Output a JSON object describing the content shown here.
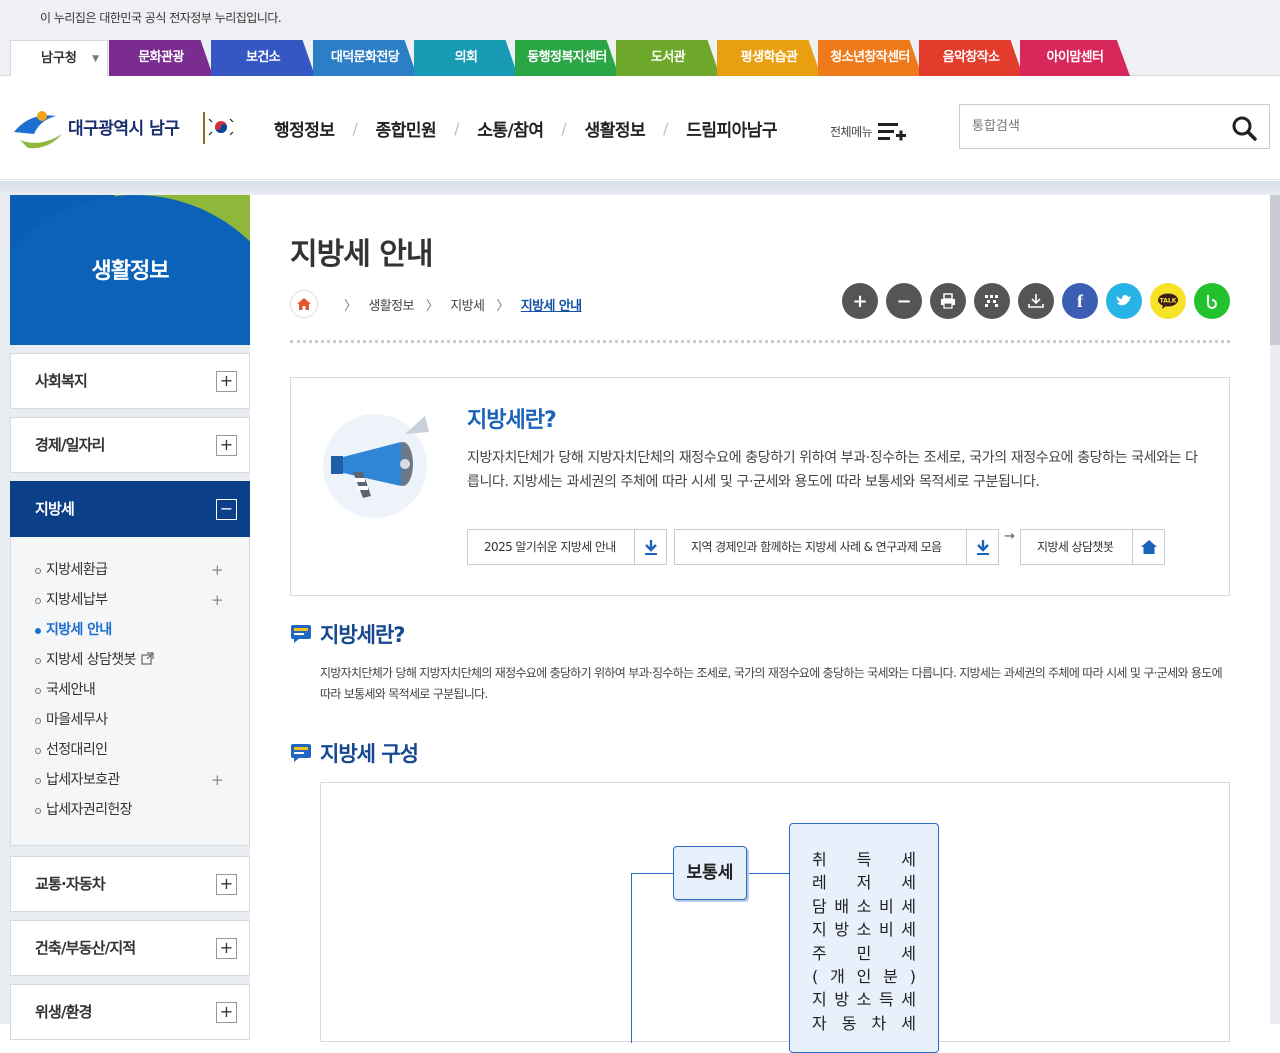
{
  "notice": "이 누리집은 대한민국 공식 전자정부 누리집입니다.",
  "site_tabs": {
    "first": "남구청",
    "items": [
      {
        "label": "문화관광",
        "color": "#7a2c8f"
      },
      {
        "label": "보건소",
        "color": "#3557c4"
      },
      {
        "label": "대덕문화전당",
        "color": "#2c7fc7"
      },
      {
        "label": "의회",
        "color": "#1a9bb5"
      },
      {
        "label": "동행정복지센터",
        "color": "#2aa645"
      },
      {
        "label": "도서관",
        "color": "#6ea82b"
      },
      {
        "label": "평생학습관",
        "color": "#e8a010"
      },
      {
        "label": "청소년창작센터",
        "color": "#ee7a1b"
      },
      {
        "label": "음악창작소",
        "color": "#e33b2c"
      },
      {
        "label": "아이맘센터",
        "color": "#d8275a"
      }
    ]
  },
  "header": {
    "logo_text": "대구광역시 남구",
    "gnb": [
      "행정정보",
      "종합민원",
      "소통/참여",
      "생활정보",
      "드림피아남구"
    ],
    "all_menu": "전체메뉴",
    "search_placeholder": "통합검색"
  },
  "sidebar": {
    "title": "생활정보",
    "menu_top": [
      {
        "label": "사회복지",
        "toggle": "+"
      },
      {
        "label": "경제/일자리",
        "toggle": "+"
      }
    ],
    "active": {
      "label": "지방세",
      "toggle": "−"
    },
    "sub_items": [
      {
        "label": "지방세환급",
        "plus": "+"
      },
      {
        "label": "지방세납부",
        "plus": "+"
      },
      {
        "label": "지방세 안내"
      },
      {
        "label": "지방세 상담챗봇"
      },
      {
        "label": "국세안내"
      },
      {
        "label": "마을세무사"
      },
      {
        "label": "선정대리인"
      },
      {
        "label": "납세자보호관",
        "plus": "+"
      },
      {
        "label": "납세자권리헌장"
      }
    ],
    "menu_bottom": [
      {
        "label": "교통·자동차",
        "toggle": "+"
      },
      {
        "label": "건축/부동산/지적",
        "toggle": "+"
      },
      {
        "label": "위생/환경",
        "toggle": "+"
      }
    ]
  },
  "content": {
    "title": "지방세 안내",
    "breadcrumb": [
      "생활정보",
      "지방세",
      "지방세 안내"
    ],
    "tools": [
      {
        "name": "zoom-in",
        "symbol": "+",
        "color": "#555555"
      },
      {
        "name": "zoom-out",
        "symbol": "−",
        "color": "#555555"
      },
      {
        "name": "print",
        "color": "#555555"
      },
      {
        "name": "qr",
        "color": "#555555"
      },
      {
        "name": "download",
        "color": "#555555"
      },
      {
        "name": "facebook",
        "symbol": "f",
        "color": "#3b5db3"
      },
      {
        "name": "twitter",
        "color": "#27b3e6"
      },
      {
        "name": "kakaotalk",
        "color": "#f7e22a"
      },
      {
        "name": "band",
        "color": "#22c22e"
      }
    ],
    "intro": {
      "heading": "지방세란?",
      "text": "지방자치단체가 당해 지방자치단체의 재정수요에 충당하기 위하여 부과·징수하는 조세로, 국가의 재정수요에 충당하는 국세와는 다릅니다. 지방세는 과세권의 주체에 따라 시세 및 구·군세와 용도에 따라 보통세와 목적세로 구분됩니다.",
      "btn1": "2025 알기쉬운 지방세 안내",
      "btn2": "지역 경제인과 함께하는 지방세 사례 & 연구과제 모음",
      "arrow": "→",
      "btn3": "지방세 상담챗봇"
    },
    "section1": {
      "heading": "지방세란?",
      "text": "지방자치단체가 당해 지방자치단체의 재정수요에 충당하기 위하여 부과·징수하는 조세로, 국가의 재정수요에 충당하는 국세와는 다릅니다. 지방세는 과세권의 주체에 따라 시세 및 구·군세와 용도에 따라 보통세와 목적세로 구분됩니다."
    },
    "section2": {
      "heading": "지방세 구성",
      "node": "보통세",
      "taxes": [
        [
          "취",
          "득",
          "세"
        ],
        [
          "레",
          "저",
          "세"
        ],
        [
          "담",
          "배",
          "소",
          "비",
          "세"
        ],
        [
          "지",
          "방",
          "소",
          "비",
          "세"
        ],
        [
          "주",
          "민",
          "세"
        ],
        [
          "(",
          "개",
          "인",
          "분",
          ")"
        ],
        [
          "지",
          "방",
          "소",
          "득",
          "세"
        ],
        [
          "자",
          "동",
          "차",
          "세"
        ]
      ]
    }
  }
}
